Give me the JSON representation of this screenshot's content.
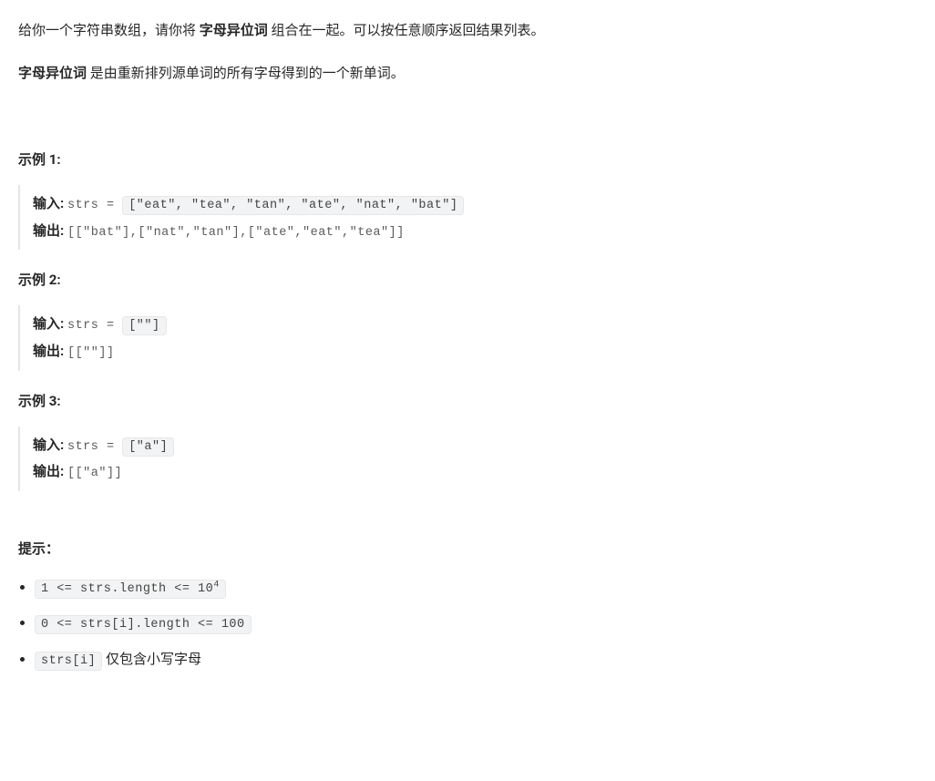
{
  "intro": {
    "line1_prefix": "给你一个字符串数组，请你将 ",
    "line1_bold": "字母异位词",
    "line1_suffix": " 组合在一起。可以按任意顺序返回结果列表。",
    "line2_bold": "字母异位词",
    "line2_suffix": " 是由重新排列源单词的所有字母得到的一个新单词。"
  },
  "examples": [
    {
      "heading": "示例 1:",
      "input_label": "输入: ",
      "input_prefix": "strs = ",
      "input_value": "[\"eat\", \"tea\", \"tan\", \"ate\", \"nat\", \"bat\"]",
      "output_label": "输出: ",
      "output_value": "[[\"bat\"],[\"nat\",\"tan\"],[\"ate\",\"eat\",\"tea\"]]"
    },
    {
      "heading": "示例 2:",
      "input_label": "输入: ",
      "input_prefix": "strs = ",
      "input_value": "[\"\"]",
      "output_label": "输出: ",
      "output_value": "[[\"\"]]"
    },
    {
      "heading": "示例 3:",
      "input_label": "输入: ",
      "input_prefix": "strs = ",
      "input_value": "[\"a\"]",
      "output_label": "输出: ",
      "output_value": "[[\"a\"]]"
    }
  ],
  "constraints": {
    "heading": "提示：",
    "items": [
      {
        "code_prefix": "1 <= strs.length <= 10",
        "code_sup": "4",
        "text_after": ""
      },
      {
        "code_prefix": "0 <= strs[i].length <= 100",
        "code_sup": "",
        "text_after": ""
      },
      {
        "code_prefix": "strs[i]",
        "code_sup": "",
        "text_after": " 仅包含小写字母"
      }
    ]
  }
}
